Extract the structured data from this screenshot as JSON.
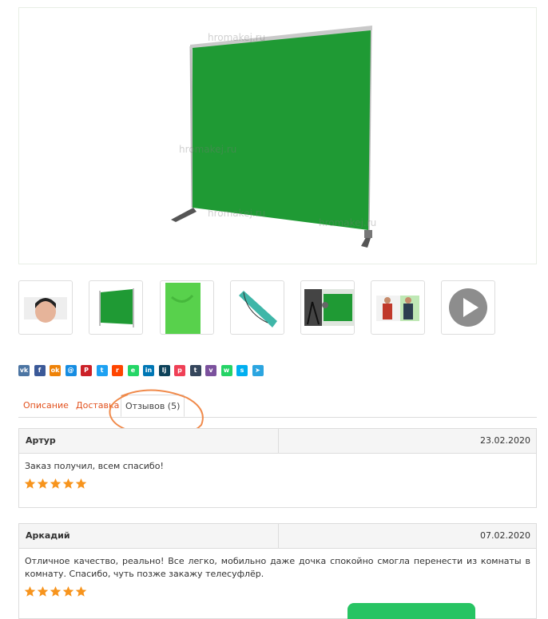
{
  "main_image": {
    "alt": "green chroma key backdrop on stand",
    "watermark": "hromakej.ru",
    "colors": {
      "screen": "#1f9a34",
      "frame": "#bdbdbd"
    }
  },
  "thumbnails": [
    {
      "alt": "portrait photo"
    },
    {
      "alt": "green backdrop stand"
    },
    {
      "alt": "green fabric closeup"
    },
    {
      "alt": "carry bag"
    },
    {
      "alt": "studio setup"
    },
    {
      "alt": "people in front of screen"
    },
    {
      "alt": "video play"
    }
  ],
  "share_icons": [
    {
      "name": "vk-icon",
      "glyph": "vk",
      "color": "#4c75a3"
    },
    {
      "name": "facebook-icon",
      "glyph": "f",
      "color": "#3b5998"
    },
    {
      "name": "odnoklassniki-icon",
      "glyph": "ok",
      "color": "#ee8208"
    },
    {
      "name": "moimir-icon",
      "glyph": "@",
      "color": "#168de2"
    },
    {
      "name": "pinterest-icon",
      "glyph": "P",
      "color": "#cb2027"
    },
    {
      "name": "twitter-icon",
      "glyph": "t",
      "color": "#1da1f2"
    },
    {
      "name": "reddit-icon",
      "glyph": "r",
      "color": "#ff4500"
    },
    {
      "name": "evernote-icon",
      "glyph": "e",
      "color": "#24d666"
    },
    {
      "name": "linkedin-icon",
      "glyph": "in",
      "color": "#0077b5"
    },
    {
      "name": "lj-icon",
      "glyph": "lj",
      "color": "#0d425a"
    },
    {
      "name": "pocket-icon",
      "glyph": "p",
      "color": "#ef4056"
    },
    {
      "name": "tumblr-icon",
      "glyph": "t",
      "color": "#35465c"
    },
    {
      "name": "viber-icon",
      "glyph": "v",
      "color": "#7b519d"
    },
    {
      "name": "whatsapp-icon",
      "glyph": "w",
      "color": "#25d366"
    },
    {
      "name": "skype-icon",
      "glyph": "s",
      "color": "#00aff0"
    },
    {
      "name": "telegram-icon",
      "glyph": "➤",
      "color": "#2ca5e0"
    }
  ],
  "tabs": {
    "description": "Описание",
    "delivery": "Доставка",
    "reviews": "Отзывов (5)"
  },
  "annotation_color": "#f08a4b",
  "star_color": "#f7941d",
  "reviews": [
    {
      "name": "Артур",
      "date": "23.02.2020",
      "text": "Заказ получил, всем спасибо!",
      "rating": 5
    },
    {
      "name": "Аркадий",
      "date": "07.02.2020",
      "text": "Отличное качество, реально! Все легко, мобильно даже дочка спокойно смогла перенести из комнаты в комнату. Спасибо, чуть позже закажу телесуфлёр.",
      "rating": 5
    }
  ]
}
